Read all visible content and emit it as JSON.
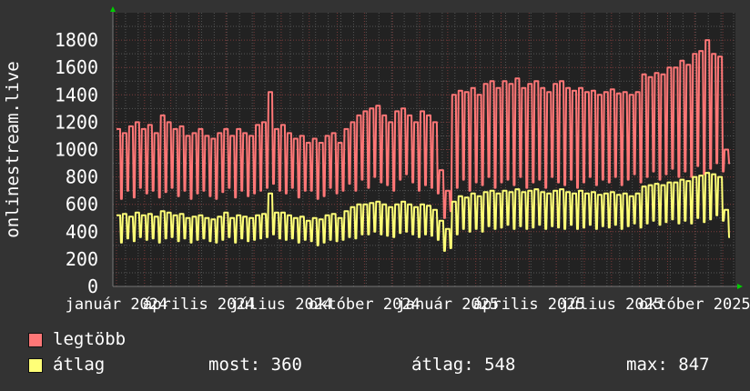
{
  "chart_data": {
    "type": "line",
    "ylabel": "onlinestream.live",
    "ylim": [
      0,
      2000
    ],
    "yticks": [
      0,
      200,
      400,
      600,
      800,
      1000,
      1200,
      1400,
      1600,
      1800
    ],
    "xlim": [
      "2023-12-28",
      "2025-11-15"
    ],
    "xticks": [
      {
        "date": "2024-01-01",
        "label": "január 2024"
      },
      {
        "date": "2024-04-01",
        "label": "április 2024"
      },
      {
        "date": "2024-07-01",
        "label": "július 2024"
      },
      {
        "date": "2024-10-01",
        "label": "október 2024"
      },
      {
        "date": "2025-01-01",
        "label": "január 2025"
      },
      {
        "date": "2025-04-01",
        "label": "április 2025"
      },
      {
        "date": "2025-07-01",
        "label": "július 2025"
      },
      {
        "date": "2025-10-01",
        "label": "október 2025"
      }
    ],
    "grid": true,
    "legend_position": "bottom",
    "series_start": "2024-01-01",
    "series_step_days": 7,
    "series": [
      {
        "name": "legtöbb",
        "color": "#ff7777",
        "weekday": [
          1150,
          1120,
          1170,
          1200,
          1150,
          1180,
          1120,
          1250,
          1200,
          1150,
          1170,
          1100,
          1120,
          1150,
          1100,
          1080,
          1120,
          1150,
          1100,
          1150,
          1120,
          1100,
          1180,
          1200,
          1420,
          1150,
          1180,
          1120,
          1080,
          1100,
          1050,
          1080,
          1050,
          1100,
          1120,
          1050,
          1150,
          1200,
          1250,
          1280,
          1300,
          1320,
          1250,
          1200,
          1280,
          1300,
          1250,
          1200,
          1280,
          1250,
          1200,
          850,
          700,
          1400,
          1430,
          1420,
          1450,
          1400,
          1480,
          1500,
          1450,
          1500,
          1480,
          1520,
          1450,
          1480,
          1500,
          1450,
          1420,
          1480,
          1500,
          1450,
          1430,
          1450,
          1420,
          1430,
          1400,
          1420,
          1440,
          1410,
          1420,
          1400,
          1420,
          1550,
          1530,
          1560,
          1550,
          1600,
          1600,
          1650,
          1620,
          1700,
          1720,
          1800,
          1700,
          1680,
          1000
        ],
        "weekend": [
          640,
          700,
          650,
          720,
          680,
          700,
          650,
          690,
          720,
          660,
          700,
          640,
          680,
          700,
          660,
          640,
          690,
          720,
          650,
          700,
          660,
          680,
          700,
          720,
          750,
          700,
          680,
          720,
          650,
          700,
          700,
          640,
          660,
          720,
          680,
          700,
          750,
          700,
          780,
          720,
          800,
          760,
          740,
          700,
          780,
          820,
          760,
          700,
          740,
          720,
          680,
          500,
          550,
          720,
          780,
          700,
          760,
          740,
          800,
          720,
          760,
          780,
          740,
          800,
          720,
          760,
          780,
          720,
          800,
          760,
          740,
          780,
          720,
          760,
          800,
          740,
          780,
          760,
          800,
          740,
          780,
          820,
          760,
          800,
          840,
          780,
          820,
          860,
          800,
          840,
          800,
          880,
          820,
          860,
          900,
          840,
          900
        ]
      },
      {
        "name": "átlag",
        "color": "#ffff77",
        "weekday": [
          520,
          530,
          510,
          540,
          520,
          530,
          510,
          550,
          540,
          520,
          530,
          500,
          510,
          520,
          500,
          490,
          510,
          540,
          500,
          520,
          510,
          500,
          520,
          530,
          680,
          540,
          540,
          520,
          500,
          510,
          480,
          500,
          490,
          520,
          530,
          500,
          550,
          580,
          600,
          600,
          610,
          620,
          600,
          580,
          600,
          620,
          600,
          580,
          600,
          590,
          560,
          480,
          420,
          620,
          660,
          650,
          680,
          660,
          690,
          700,
          680,
          700,
          690,
          710,
          690,
          700,
          710,
          690,
          680,
          700,
          710,
          690,
          680,
          700,
          680,
          690,
          670,
          680,
          690,
          670,
          680,
          660,
          680,
          730,
          740,
          750,
          740,
          760,
          760,
          780,
          770,
          800,
          810,
          830,
          820,
          800,
          560
        ],
        "weekend": [
          320,
          350,
          330,
          360,
          340,
          350,
          320,
          350,
          360,
          330,
          350,
          320,
          340,
          350,
          330,
          320,
          340,
          360,
          320,
          350,
          330,
          340,
          350,
          360,
          380,
          350,
          340,
          350,
          320,
          340,
          330,
          300,
          320,
          340,
          330,
          340,
          360,
          350,
          380,
          380,
          400,
          380,
          370,
          360,
          390,
          400,
          380,
          360,
          380,
          370,
          340,
          260,
          280,
          380,
          420,
          400,
          420,
          400,
          440,
          420,
          430,
          450,
          420,
          440,
          420,
          430,
          450,
          420,
          440,
          430,
          420,
          450,
          420,
          430,
          450,
          420,
          440,
          430,
          450,
          420,
          440,
          460,
          430,
          460,
          480,
          450,
          470,
          490,
          460,
          480,
          460,
          500,
          470,
          490,
          520,
          480,
          360
        ]
      }
    ]
  },
  "legend": {
    "max_label": "legtöbb",
    "avg_label": "átlag",
    "now": "most: 360",
    "average": "átlag: 548",
    "maximum": "max: 847"
  }
}
